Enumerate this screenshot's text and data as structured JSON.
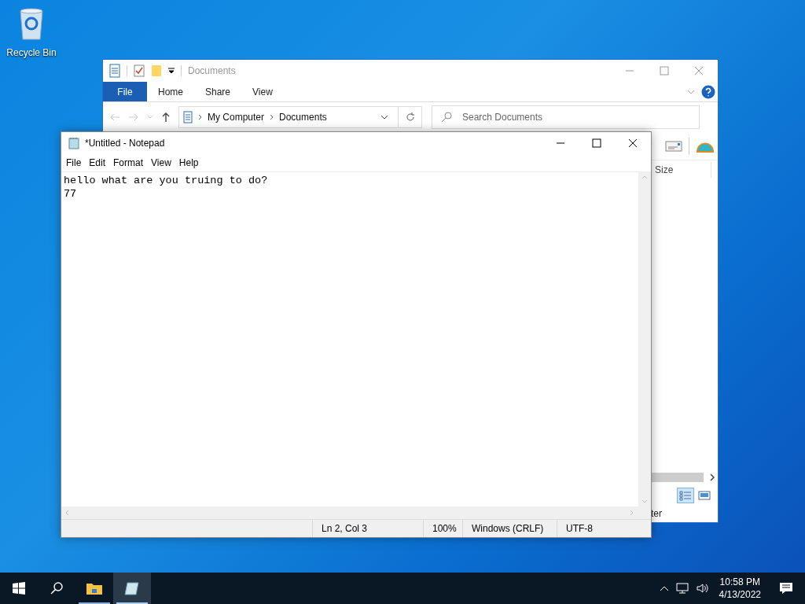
{
  "desktop_icons": [
    {
      "label": "Recycle Bin"
    }
  ],
  "explorer": {
    "title": "Documents",
    "file_tab": "File",
    "tabs": [
      "Home",
      "Share",
      "View"
    ],
    "breadcrumb": [
      "My Computer",
      "Documents"
    ],
    "search": {
      "placeholder": "Search Documents"
    },
    "column_header": "Size",
    "view_buttons": [
      {
        "kind": "details",
        "selected": true
      },
      {
        "kind": "tiles",
        "selected": false
      }
    ],
    "status_text": "ter"
  },
  "notepad": {
    "title": "*Untitled - Notepad",
    "menu": [
      "File",
      "Edit",
      "Format",
      "View",
      "Help"
    ],
    "lines": [
      "hello what are you truing to do?",
      "77"
    ],
    "status_bar": [
      "Ln 2, Col 3",
      "100%",
      "Windows (CRLF)",
      "UTF-8"
    ]
  },
  "taskbar": {
    "apps": [
      {
        "kind": "explorer",
        "selected": false
      },
      {
        "kind": "notepad",
        "selected": true
      }
    ],
    "time": "10:58 PM",
    "date": "4/13/2022"
  }
}
